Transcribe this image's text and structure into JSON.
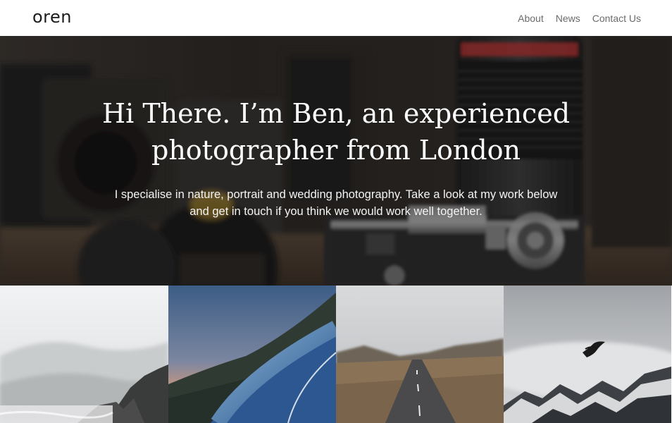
{
  "header": {
    "logo": "oren",
    "nav": [
      {
        "label": "About"
      },
      {
        "label": "News"
      },
      {
        "label": "Contact Us"
      }
    ]
  },
  "hero": {
    "title": "Hi There. I’m Ben, an experienced photographer from London",
    "subtitle": "I specialise in nature, portrait and wedding photography. Take a look at my work below and get in touch if you think we would work well together."
  },
  "gallery": {
    "tiles": [
      {
        "subject": "misty-coast-photo"
      },
      {
        "subject": "mountain-road-guardrail-photo"
      },
      {
        "subject": "highland-road-photo"
      },
      {
        "subject": "bird-over-snowy-mountains-photo"
      }
    ]
  },
  "colors": {
    "header_bg": "#ffffff",
    "logo": "#1c1c1c",
    "nav_text": "#6b6b6b",
    "hero_text": "#ffffff"
  }
}
